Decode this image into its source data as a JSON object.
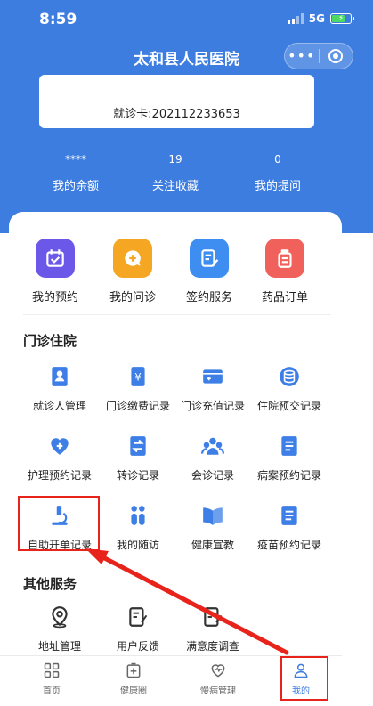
{
  "status_bar": {
    "time": "8:59",
    "network": "5G"
  },
  "header": {
    "title": "太和县人民医院",
    "capsule_more": "•••"
  },
  "card": {
    "card_number": "就诊卡:202112233653"
  },
  "stats": [
    {
      "value": "****",
      "label": "我的余额"
    },
    {
      "value": "19",
      "label": "关注收藏"
    },
    {
      "value": "0",
      "label": "我的提问"
    }
  ],
  "quick_actions": [
    {
      "label": "我的预约",
      "icon": "calendar-check-icon",
      "color": "#6b57e8"
    },
    {
      "label": "我的问诊",
      "icon": "chat-plus-icon",
      "color": "#f5a623"
    },
    {
      "label": "签约服务",
      "icon": "document-edit-icon",
      "color": "#3d8ef0"
    },
    {
      "label": "药品订单",
      "icon": "medicine-bottle-icon",
      "color": "#f0615c"
    }
  ],
  "outpatient": {
    "title": "门诊住院",
    "items": [
      {
        "label": "就诊人管理",
        "icon": "patient-card-icon"
      },
      {
        "label": "门诊缴费记录",
        "icon": "yuan-receipt-icon"
      },
      {
        "label": "门诊充值记录",
        "icon": "card-recharge-icon"
      },
      {
        "label": "住院预交记录",
        "icon": "coin-stack-icon"
      },
      {
        "label": "护理预约记录",
        "icon": "heart-plus-icon"
      },
      {
        "label": "转诊记录",
        "icon": "transfer-arrows-icon"
      },
      {
        "label": "会诊记录",
        "icon": "group-people-icon"
      },
      {
        "label": "病案预约记录",
        "icon": "medical-record-icon"
      },
      {
        "label": "自助开单记录",
        "icon": "microscope-icon"
      },
      {
        "label": "我的随访",
        "icon": "follow-up-icon"
      },
      {
        "label": "健康宣教",
        "icon": "open-book-icon"
      },
      {
        "label": "疫苗预约记录",
        "icon": "vaccine-record-icon"
      }
    ]
  },
  "other": {
    "title": "其他服务",
    "items": [
      {
        "label": "地址管理",
        "icon": "location-pin-icon"
      },
      {
        "label": "用户反馈",
        "icon": "feedback-edit-icon"
      },
      {
        "label": "满意度调查",
        "icon": "survey-edit-icon"
      }
    ]
  },
  "tabbar": [
    {
      "label": "首页",
      "icon": "home-grid-icon",
      "active": false
    },
    {
      "label": "健康圈",
      "icon": "health-circle-icon",
      "active": false
    },
    {
      "label": "慢病管理",
      "icon": "chronic-heart-icon",
      "active": false
    },
    {
      "label": "我的",
      "icon": "profile-icon",
      "active": true
    }
  ],
  "colors": {
    "primary": "#3e7de0",
    "icon_blue": "#3d7fe6",
    "annotation_red": "#e8231b"
  }
}
